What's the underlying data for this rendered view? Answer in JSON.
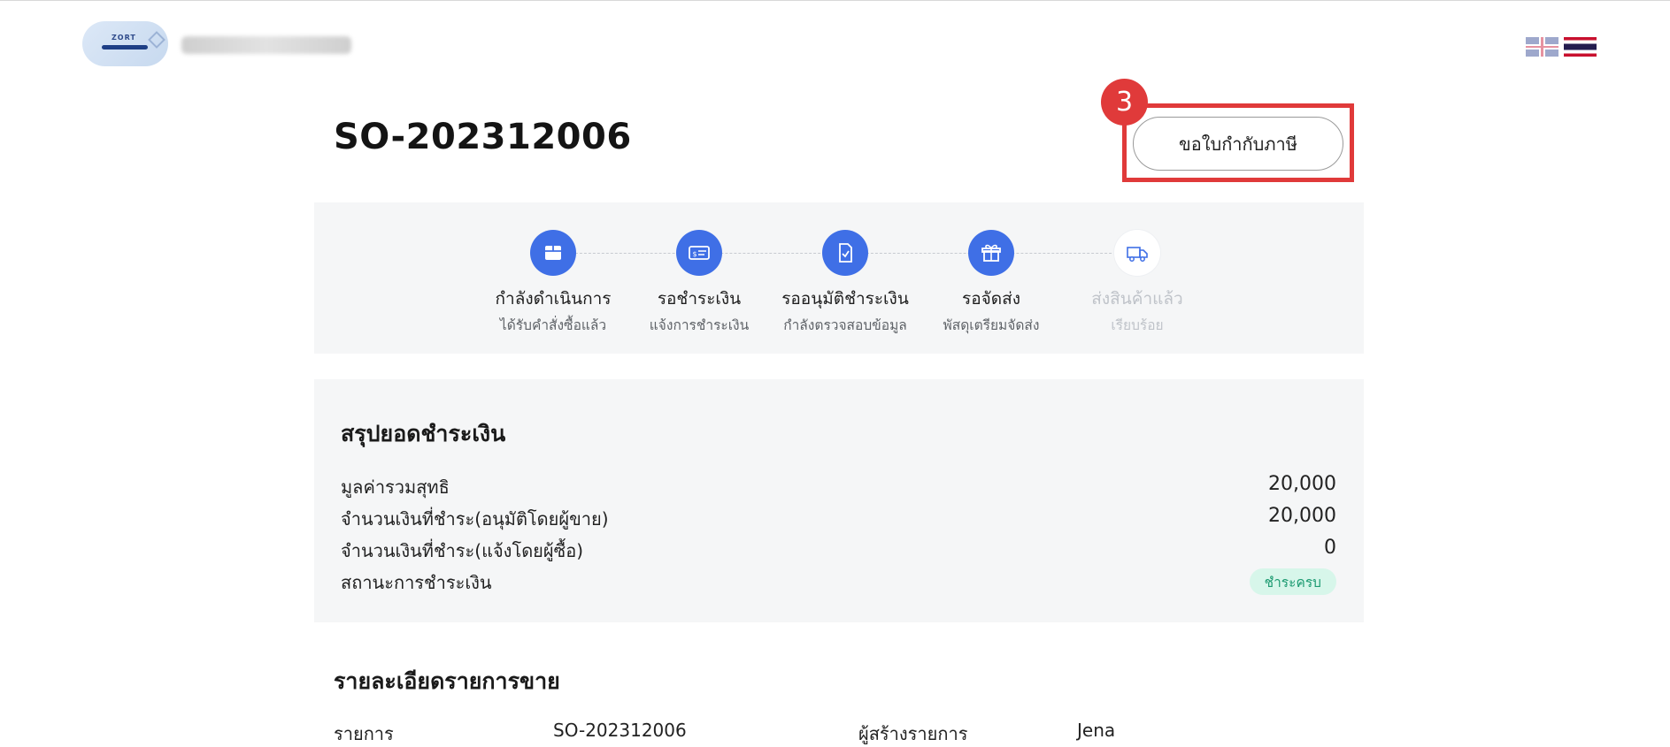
{
  "header": {
    "logo_text": "ZORT",
    "languages": [
      "English",
      "ไทย"
    ]
  },
  "order": {
    "title": "SO-202312006",
    "request_tax_invoice_label": "ขอใบกำกับภาษี",
    "annotation_number": "3",
    "annotation_color": "#e03a3a"
  },
  "steps": [
    {
      "title": "กำลังดำเนินการ",
      "subtitle": "ได้รับคำสั่งซื้อแล้ว",
      "icon": "box-icon",
      "active": true
    },
    {
      "title": "รอชำระเงิน",
      "subtitle": "แจ้งการชำระเงิน",
      "icon": "payment-card-icon",
      "active": true
    },
    {
      "title": "รออนุมัติชำระเงิน",
      "subtitle": "กำลังตรวจสอบข้อมูล",
      "icon": "document-check-icon",
      "active": true
    },
    {
      "title": "รอจัดส่ง",
      "subtitle": "พัสดุเตรียมจัดส่ง",
      "icon": "gift-box-icon",
      "active": true
    },
    {
      "title": "ส่งสินค้าแล้ว",
      "subtitle": "เรียบร้อย",
      "icon": "delivery-truck-icon",
      "active": false
    }
  ],
  "colors": {
    "accent": "#3f6fe6",
    "paid_badge_bg": "#d7f6ea",
    "paid_badge_text": "#1d9b72"
  },
  "summary": {
    "title": "สรุปยอดชำระเงิน",
    "rows": [
      {
        "label": "มูลค่ารวมสุทธิ",
        "value": "20,000"
      },
      {
        "label": "จำนวนเงินที่ชำระ(อนุมัติโดยผู้ขาย)",
        "value": "20,000"
      },
      {
        "label": "จำนวนเงินที่ชำระ(แจ้งโดยผู้ซื้อ)",
        "value": "0"
      },
      {
        "label": "สถานะการชำระเงิน",
        "value": "ชำระครบ"
      }
    ]
  },
  "details": {
    "title": "รายละเอียดรายการขาย",
    "order_label": "รายการ",
    "order_value": "SO-202312006",
    "creator_label": "ผู้สร้างรายการ",
    "creator_value": "Jena"
  }
}
